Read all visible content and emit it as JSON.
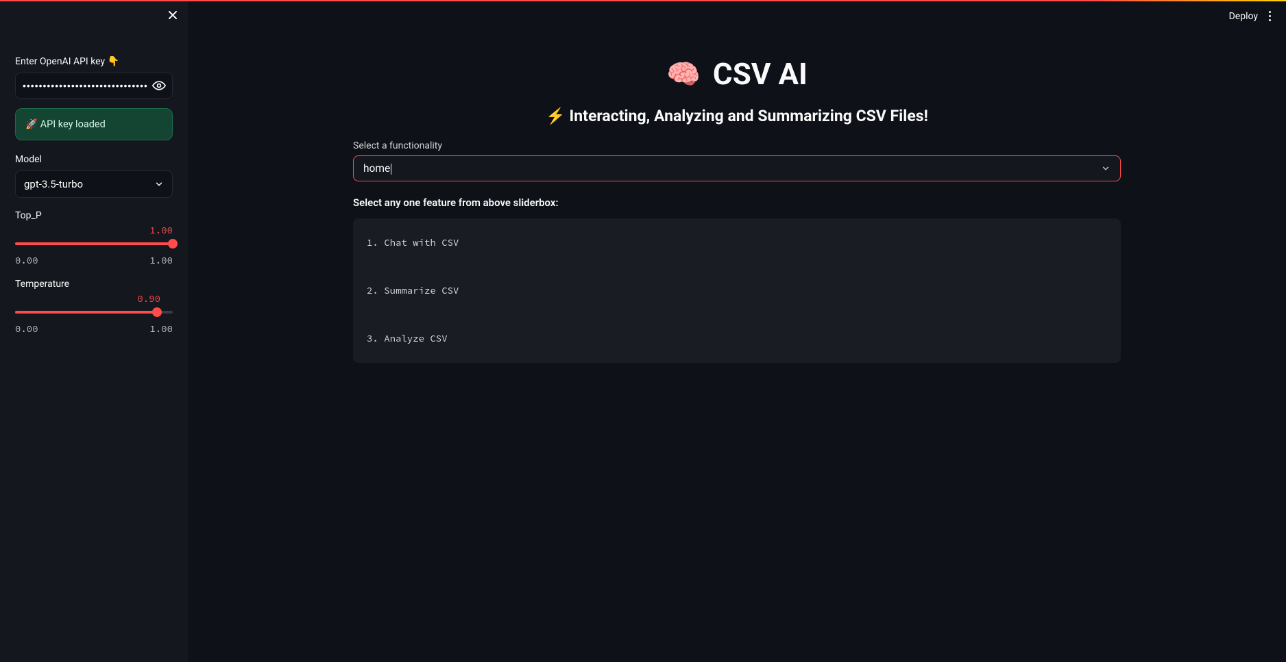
{
  "topbar": {
    "deploy": "Deploy"
  },
  "sidebar": {
    "api_key_label": "Enter OpenAI API key 👇",
    "api_key_value": "••••••••••••••••••••••••••••••••••••••••••••••••••••",
    "success_message": "🚀 API key loaded",
    "model_label": "Model",
    "model_value": "gpt-3.5-turbo",
    "top_p": {
      "label": "Top_P",
      "value": "1.00",
      "min": "0.00",
      "max": "1.00",
      "percent": 100
    },
    "temperature": {
      "label": "Temperature",
      "value": "0.90",
      "min": "0.00",
      "max": "1.00",
      "percent": 90
    }
  },
  "main": {
    "title_emoji": "🧠",
    "title_text": "CSV AI",
    "subtitle": "⚡ Interacting, Analyzing and Summarizing CSV Files!",
    "func_label": "Select a functionality",
    "func_value": "home",
    "prompt_text": "Select any one feature from above sliderbox:",
    "code_block": "1. Chat with CSV\n\n2. Summarize CSV\n\n3. Analyze CSV"
  }
}
